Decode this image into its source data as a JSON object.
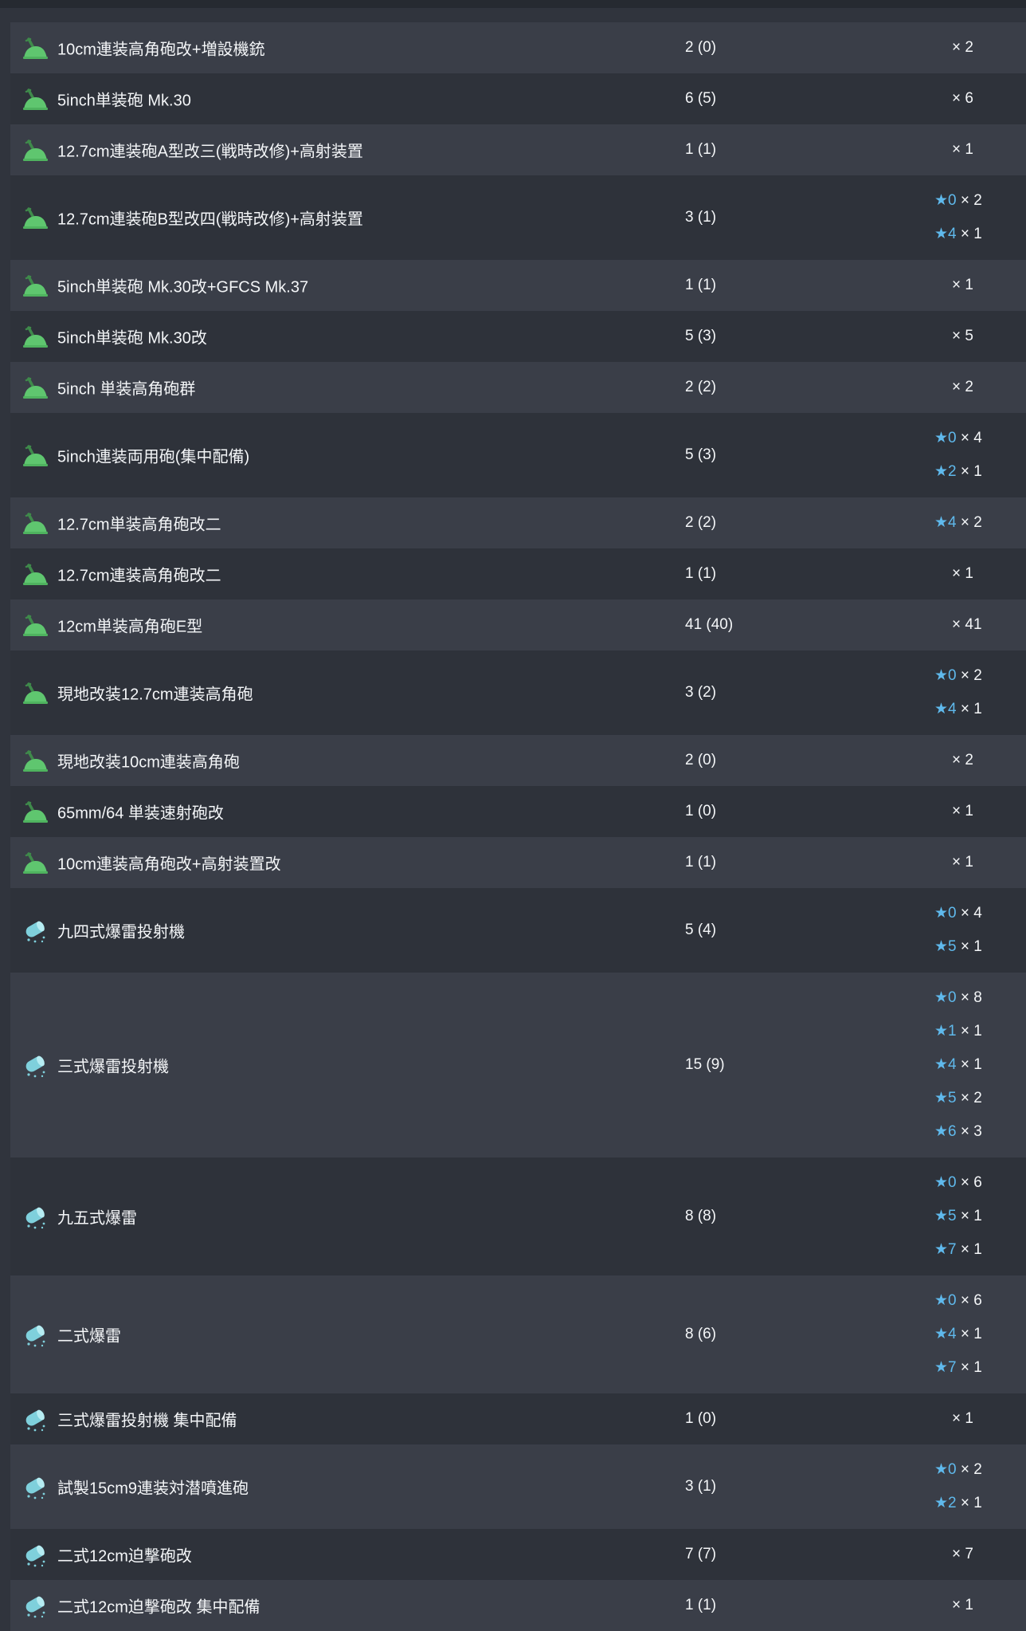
{
  "colors": {
    "background": "#30343d",
    "row_odd": "#3a3e48",
    "row_even": "#2e323a",
    "star": "#5fb9ec",
    "gun_icon": "#5fc66f",
    "depth_charge_icon": "#7fd0dc"
  },
  "items": [
    {
      "icon": "high-angle-gun-icon",
      "name": "10cm連装高角砲改+増設機銃",
      "count": "2 (0)",
      "levels": [
        {
          "star": "",
          "qty": "× 2"
        }
      ]
    },
    {
      "icon": "high-angle-gun-icon",
      "name": "5inch単装砲 Mk.30",
      "count": "6 (5)",
      "levels": [
        {
          "star": "",
          "qty": "× 6"
        }
      ]
    },
    {
      "icon": "high-angle-gun-icon",
      "name": "12.7cm連装砲A型改三(戦時改修)+高射装置",
      "count": "1 (1)",
      "levels": [
        {
          "star": "",
          "qty": "× 1"
        }
      ]
    },
    {
      "icon": "high-angle-gun-icon",
      "name": "12.7cm連装砲B型改四(戦時改修)+高射装置",
      "count": "3 (1)",
      "levels": [
        {
          "star": "★0",
          "qty": "× 2"
        },
        {
          "star": "★4",
          "qty": "× 1"
        }
      ]
    },
    {
      "icon": "high-angle-gun-icon",
      "name": "5inch単装砲 Mk.30改+GFCS Mk.37",
      "count": "1 (1)",
      "levels": [
        {
          "star": "",
          "qty": "× 1"
        }
      ]
    },
    {
      "icon": "high-angle-gun-icon",
      "name": "5inch単装砲 Mk.30改",
      "count": "5 (3)",
      "levels": [
        {
          "star": "",
          "qty": "× 5"
        }
      ]
    },
    {
      "icon": "high-angle-gun-icon",
      "name": "5inch 単装高角砲群",
      "count": "2 (2)",
      "levels": [
        {
          "star": "",
          "qty": "× 2"
        }
      ]
    },
    {
      "icon": "high-angle-gun-icon",
      "name": "5inch連装両用砲(集中配備)",
      "count": "5 (3)",
      "levels": [
        {
          "star": "★0",
          "qty": "× 4"
        },
        {
          "star": "★2",
          "qty": "× 1"
        }
      ]
    },
    {
      "icon": "high-angle-gun-icon",
      "name": "12.7cm単装高角砲改二",
      "count": "2 (2)",
      "levels": [
        {
          "star": "★4",
          "qty": "× 2"
        }
      ]
    },
    {
      "icon": "high-angle-gun-icon",
      "name": "12.7cm連装高角砲改二",
      "count": "1 (1)",
      "levels": [
        {
          "star": "",
          "qty": "× 1"
        }
      ]
    },
    {
      "icon": "high-angle-gun-icon",
      "name": "12cm単装高角砲E型",
      "count": "41 (40)",
      "levels": [
        {
          "star": "",
          "qty": "× 41"
        }
      ]
    },
    {
      "icon": "high-angle-gun-icon",
      "name": "現地改装12.7cm連装高角砲",
      "count": "3 (2)",
      "levels": [
        {
          "star": "★0",
          "qty": "× 2"
        },
        {
          "star": "★4",
          "qty": "× 1"
        }
      ]
    },
    {
      "icon": "high-angle-gun-icon",
      "name": "現地改装10cm連装高角砲",
      "count": "2 (0)",
      "levels": [
        {
          "star": "",
          "qty": "× 2"
        }
      ]
    },
    {
      "icon": "high-angle-gun-icon",
      "name": "65mm/64 単装速射砲改",
      "count": "1 (0)",
      "levels": [
        {
          "star": "",
          "qty": "× 1"
        }
      ]
    },
    {
      "icon": "high-angle-gun-icon",
      "name": "10cm連装高角砲改+高射装置改",
      "count": "1 (1)",
      "levels": [
        {
          "star": "",
          "qty": "× 1"
        }
      ]
    },
    {
      "icon": "depth-charge-icon",
      "name": "九四式爆雷投射機",
      "count": "5 (4)",
      "levels": [
        {
          "star": "★0",
          "qty": "× 4"
        },
        {
          "star": "★5",
          "qty": "× 1"
        }
      ]
    },
    {
      "icon": "depth-charge-icon",
      "name": "三式爆雷投射機",
      "count": "15 (9)",
      "levels": [
        {
          "star": "★0",
          "qty": "× 8"
        },
        {
          "star": "★1",
          "qty": "× 1"
        },
        {
          "star": "★4",
          "qty": "× 1"
        },
        {
          "star": "★5",
          "qty": "× 2"
        },
        {
          "star": "★6",
          "qty": "× 3"
        }
      ]
    },
    {
      "icon": "depth-charge-icon",
      "name": "九五式爆雷",
      "count": "8 (8)",
      "levels": [
        {
          "star": "★0",
          "qty": "× 6"
        },
        {
          "star": "★5",
          "qty": "× 1"
        },
        {
          "star": "★7",
          "qty": "× 1"
        }
      ]
    },
    {
      "icon": "depth-charge-icon",
      "name": "二式爆雷",
      "count": "8 (6)",
      "levels": [
        {
          "star": "★0",
          "qty": "× 6"
        },
        {
          "star": "★4",
          "qty": "× 1"
        },
        {
          "star": "★7",
          "qty": "× 1"
        }
      ]
    },
    {
      "icon": "depth-charge-icon",
      "name": "三式爆雷投射機 集中配備",
      "count": "1 (0)",
      "levels": [
        {
          "star": "",
          "qty": "× 1"
        }
      ]
    },
    {
      "icon": "depth-charge-icon",
      "name": "試製15cm9連装対潜噴進砲",
      "count": "3 (1)",
      "levels": [
        {
          "star": "★0",
          "qty": "× 2"
        },
        {
          "star": "★2",
          "qty": "× 1"
        }
      ]
    },
    {
      "icon": "depth-charge-icon",
      "name": "二式12cm迫撃砲改",
      "count": "7 (7)",
      "levels": [
        {
          "star": "",
          "qty": "× 7"
        }
      ]
    },
    {
      "icon": "depth-charge-icon",
      "name": "二式12cm迫撃砲改 集中配備",
      "count": "1 (1)",
      "levels": [
        {
          "star": "",
          "qty": "× 1"
        }
      ]
    }
  ]
}
